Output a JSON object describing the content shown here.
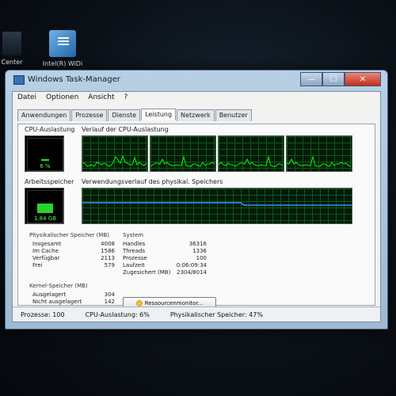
{
  "desktop": {
    "icons": [
      {
        "label": "Center"
      },
      {
        "label": "Intel(R) WiDi"
      }
    ]
  },
  "window": {
    "title": "Windows Task-Manager",
    "buttons": {
      "minimize": "—",
      "maximize": "☐",
      "close": "✕"
    }
  },
  "menu": [
    "Datei",
    "Optionen",
    "Ansicht",
    "?"
  ],
  "tabs": [
    "Anwendungen",
    "Prozesse",
    "Dienste",
    "Leistung",
    "Netzwerk",
    "Benutzer"
  ],
  "active_tab": "Leistung",
  "perf": {
    "cpu_label": "CPU-Auslastung",
    "cpu_value": "6 %",
    "cpu_fraction": 0.06,
    "cpu_history_label": "Verlauf der CPU-Auslastung",
    "mem_label": "Arbeitsspeicher",
    "mem_value": "1,84 GB",
    "mem_fraction": 0.47,
    "mem_history_label": "Verwendungsverlauf des physikal. Speichers"
  },
  "physical_memory": {
    "title": "Physikalischer Speicher (MB)",
    "rows": [
      {
        "label": "Insgesamt",
        "value": "4008"
      },
      {
        "label": "Im Cache",
        "value": "1586"
      },
      {
        "label": "Verfügbar",
        "value": "2113"
      },
      {
        "label": "Frei",
        "value": "579"
      }
    ]
  },
  "system": {
    "title": "System",
    "rows": [
      {
        "label": "Handles",
        "value": "36316"
      },
      {
        "label": "Threads",
        "value": "1336"
      },
      {
        "label": "Prozesse",
        "value": "100"
      },
      {
        "label": "Laufzeit",
        "value": "0:06:09:34"
      },
      {
        "label": "Zugesichert (MB)",
        "value": "2304/8014"
      }
    ]
  },
  "kernel_memory": {
    "title": "Kernel-Speicher (MB)",
    "rows": [
      {
        "label": "Ausgelagert",
        "value": "304"
      },
      {
        "label": "Nicht ausgelagert",
        "value": "142"
      }
    ]
  },
  "resource_monitor_button": "Ressourcenmonitor...",
  "statusbar": {
    "processes": "Prozesse: 100",
    "cpu": "CPU-Auslastung: 6%",
    "memory": "Physikalischer Speicher: 47%"
  },
  "colors": {
    "graph_line": "#00ff00",
    "mem_line": "#3c8cff",
    "grid": "#0c5a1a"
  }
}
